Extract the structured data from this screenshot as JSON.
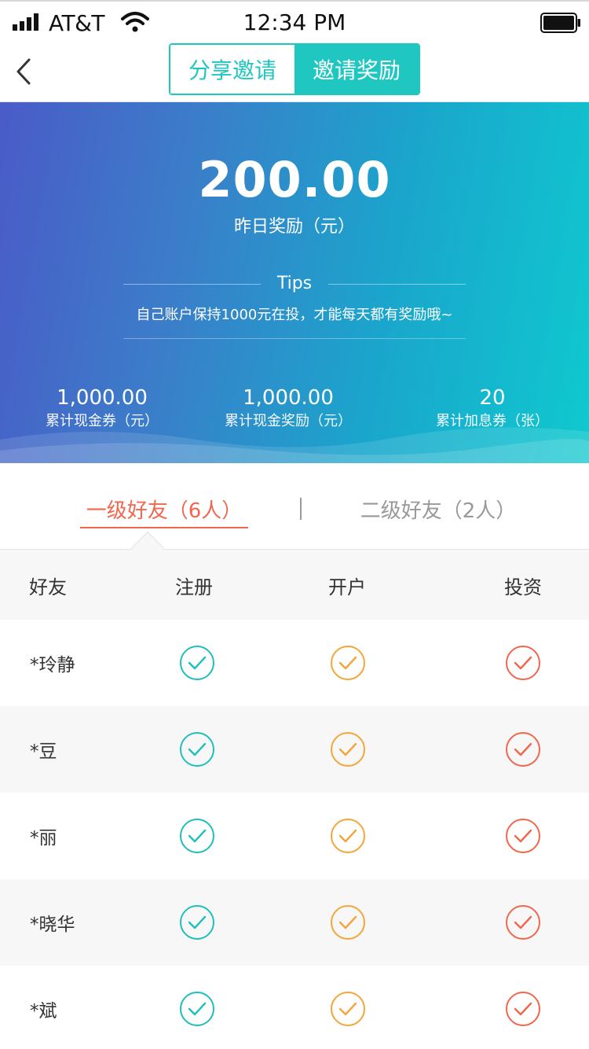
{
  "status_bar": {
    "carrier": "AT&T",
    "time": "12:34 PM"
  },
  "nav": {
    "back_icon": "chevron-left-icon",
    "tabs": [
      {
        "label": "分享邀请",
        "active": false
      },
      {
        "label": "邀请奖励",
        "active": true
      }
    ]
  },
  "banner": {
    "amount": "200.00",
    "amount_label": "昨日奖励（元）",
    "tips_title": "Tips",
    "tips_text": "自己账户保持1000元在投，才能每天都有奖励哦~",
    "stats": [
      {
        "value": "1,000.00",
        "label": "累计现金券（元）"
      },
      {
        "value": "1,000.00",
        "label": "累计现金奖励（元）"
      },
      {
        "value": "20",
        "label": "累计加息券（张）"
      }
    ]
  },
  "friend_tabs": {
    "level1": "一级好友（6人）",
    "level2": "二级好友（2人）"
  },
  "table": {
    "headers": {
      "friend": "好友",
      "register": "注册",
      "open": "开户",
      "invest": "投资"
    },
    "rows": [
      {
        "name": "*玲静"
      },
      {
        "name": "*豆"
      },
      {
        "name": "*丽"
      },
      {
        "name": "*晓华"
      },
      {
        "name": "*斌"
      }
    ]
  },
  "colors": {
    "accent": "#1fc7c0",
    "register_check": "#1fbfbb",
    "open_check": "#f5a53a",
    "invest_check": "#f0674e",
    "active_tab": "#f0674e"
  }
}
